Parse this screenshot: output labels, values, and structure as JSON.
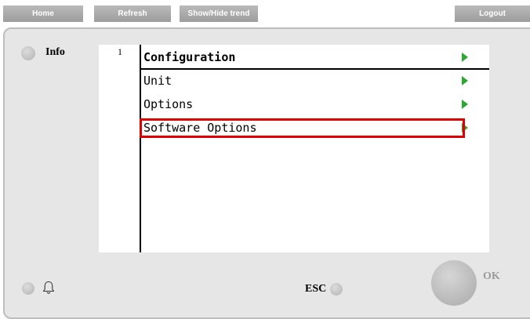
{
  "toolbar": {
    "home_label": "Home",
    "refresh_label": "Refresh",
    "trend_label": "Show/Hide trend",
    "logout_label": "Logout"
  },
  "panel": {
    "info_label": "Info",
    "esc_label": "ESC",
    "ok_label": "OK"
  },
  "display": {
    "level": "1",
    "menu_title": "Configuration",
    "items": [
      {
        "label": "Unit"
      },
      {
        "label": "Options"
      },
      {
        "label": "Software Options",
        "highlighted": true
      }
    ]
  },
  "colors": {
    "arrow": "#2aa832",
    "highlight_border": "#e00000",
    "panel_bg": "#e6e6e6",
    "toolbar_button": "#a9a9a9"
  },
  "icons": {
    "menu_arrow": "play-arrow-icon",
    "alarm": "bell-icon"
  }
}
